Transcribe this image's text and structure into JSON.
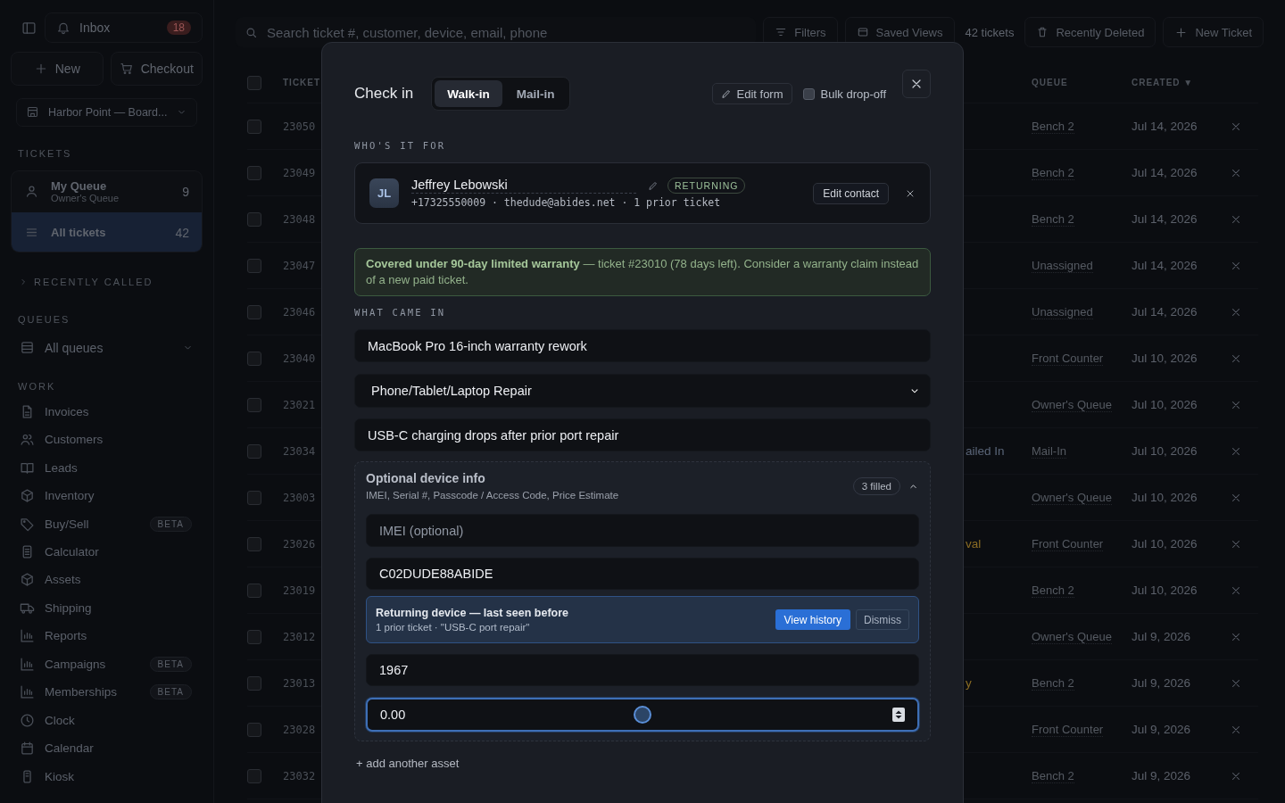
{
  "sidebar": {
    "inbox": {
      "label": "Inbox",
      "count": "18"
    },
    "actions": [
      "New",
      "Checkout"
    ],
    "location": "Harbor Point — Board...",
    "tickets_heading": "TICKETS",
    "ticket_views": [
      {
        "label": "My Queue",
        "sublabel": "Owner's Queue",
        "count": "9",
        "selected": false
      },
      {
        "label": "All tickets",
        "count": "42",
        "selected": true
      }
    ],
    "recently_called": {
      "label": "RECENTLY CALLED",
      "expanded": false
    },
    "queues_heading": "QUEUES",
    "queue_select": "All queues",
    "work_heading": "WORK",
    "work_items": [
      {
        "label": "Invoices"
      },
      {
        "label": "Customers"
      },
      {
        "label": "Leads"
      },
      {
        "label": "Inventory"
      },
      {
        "label": "Buy/Sell",
        "badge": "BETA"
      },
      {
        "label": "Calculator"
      },
      {
        "label": "Assets"
      },
      {
        "label": "Shipping"
      },
      {
        "label": "Reports"
      },
      {
        "label": "Campaigns",
        "badge": "BETA"
      },
      {
        "label": "Memberships",
        "badge": "BETA"
      },
      {
        "label": "Clock"
      },
      {
        "label": "Calendar"
      },
      {
        "label": "Kiosk"
      }
    ]
  },
  "toolbar": {
    "search": {
      "placeholder": "Search ticket #, customer, device, email, phone"
    },
    "filters": "Filters",
    "saved_views": "Saved Views",
    "ticket_count": "42 tickets",
    "recently_deleted": "Recently Deleted",
    "new_ticket": "New Ticket"
  },
  "table": {
    "select_all": {
      "checked": false
    },
    "columns": [
      "TICKET",
      "QUEUE",
      "CREATED ▼"
    ],
    "rows": [
      {
        "checked": false,
        "ticket": "23050",
        "queue": "Bench 2",
        "created": "Jul 14, 2026"
      },
      {
        "checked": false,
        "ticket": "23049",
        "queue": "Bench 2",
        "created": "Jul 14, 2026"
      },
      {
        "checked": false,
        "ticket": "23048",
        "queue": "Bench 2",
        "created": "Jul 14, 2026"
      },
      {
        "checked": false,
        "ticket": "23047",
        "queue": "Unassigned",
        "created": "Jul 14, 2026"
      },
      {
        "checked": false,
        "ticket": "23046",
        "queue": "Unassigned",
        "created": "Jul 14, 2026"
      },
      {
        "checked": false,
        "ticket": "23040",
        "queue": "Front Counter",
        "created": "Jul 10, 2026"
      },
      {
        "checked": false,
        "ticket": "23021",
        "queue": "Owner's Queue",
        "created": "Jul 10, 2026"
      },
      {
        "checked": false,
        "ticket": "23034",
        "status": "ailed In",
        "color": "#5a6578",
        "queue": "Mail-In",
        "created": "Jul 10, 2026"
      },
      {
        "checked": false,
        "ticket": "23003",
        "queue": "Owner's Queue",
        "created": "Jul 10, 2026"
      },
      {
        "checked": false,
        "ticket": "23026",
        "status": "val",
        "color": "#8c6d24",
        "queue": "Front Counter",
        "created": "Jul 10, 2026"
      },
      {
        "checked": false,
        "ticket": "23019",
        "queue": "Bench 2",
        "created": "Jul 10, 2026"
      },
      {
        "checked": false,
        "ticket": "23012",
        "queue": "Owner's Queue",
        "created": "Jul 9, 2026"
      },
      {
        "checked": false,
        "ticket": "23013",
        "status": "y",
        "color": "#8c6d24",
        "queue": "Bench 2",
        "created": "Jul 9, 2026"
      },
      {
        "checked": false,
        "ticket": "23028",
        "queue": "Front Counter",
        "created": "Jul 9, 2026"
      },
      {
        "checked": false,
        "ticket": "23032",
        "queue": "Bench 2",
        "created": "Jul 9, 2026"
      }
    ]
  },
  "dialog": {
    "title": "Check in",
    "modes": [
      {
        "label": "Walk-in",
        "selected": true
      },
      {
        "label": "Mail-in",
        "selected": false
      }
    ],
    "edit_form": "Edit form",
    "bulk_dropoff": {
      "label": "Bulk drop-off",
      "checked": false
    },
    "customer_heading": "WHO'S IT FOR",
    "customer": {
      "initials": "JL",
      "name": "Jeffrey Lebowski",
      "tag": "RETURNING",
      "details": "+17325550009 · thedude@abides.net · 1 prior ticket",
      "edit_button": "Edit contact"
    },
    "warranty_notice": "**Covered under 90-day limited warranty** — ticket #23010 (78 days left). Consider a warranty claim instead of a new paid ticket.",
    "intake_heading": "WHAT CAME IN",
    "device": {
      "value": "MacBook Pro 16-inch warranty rework"
    },
    "repair_type": {
      "value": "Phone/Tablet/Laptop Repair"
    },
    "issue": {
      "value": "USB-C charging drops after prior port repair"
    },
    "optional_info": {
      "title": "Optional device info",
      "subtitle": "IMEI, Serial #, Passcode / Access Code, Price Estimate",
      "filled": "3 filled",
      "expanded": true,
      "imei": {
        "placeholder": "IMEI (optional)"
      },
      "serial": {
        "value": "C02DUDE88ABIDE"
      },
      "returning_device": {
        "title": "Returning device — last seen before",
        "detail": "1 prior ticket · \"USB-C port repair\"",
        "actions": [
          "View history",
          "Dismiss"
        ]
      },
      "passcode": {
        "value": "1967"
      },
      "price_estimate": {
        "value": "0.00",
        "focused": true
      }
    },
    "add_asset": "+ add another asset"
  }
}
